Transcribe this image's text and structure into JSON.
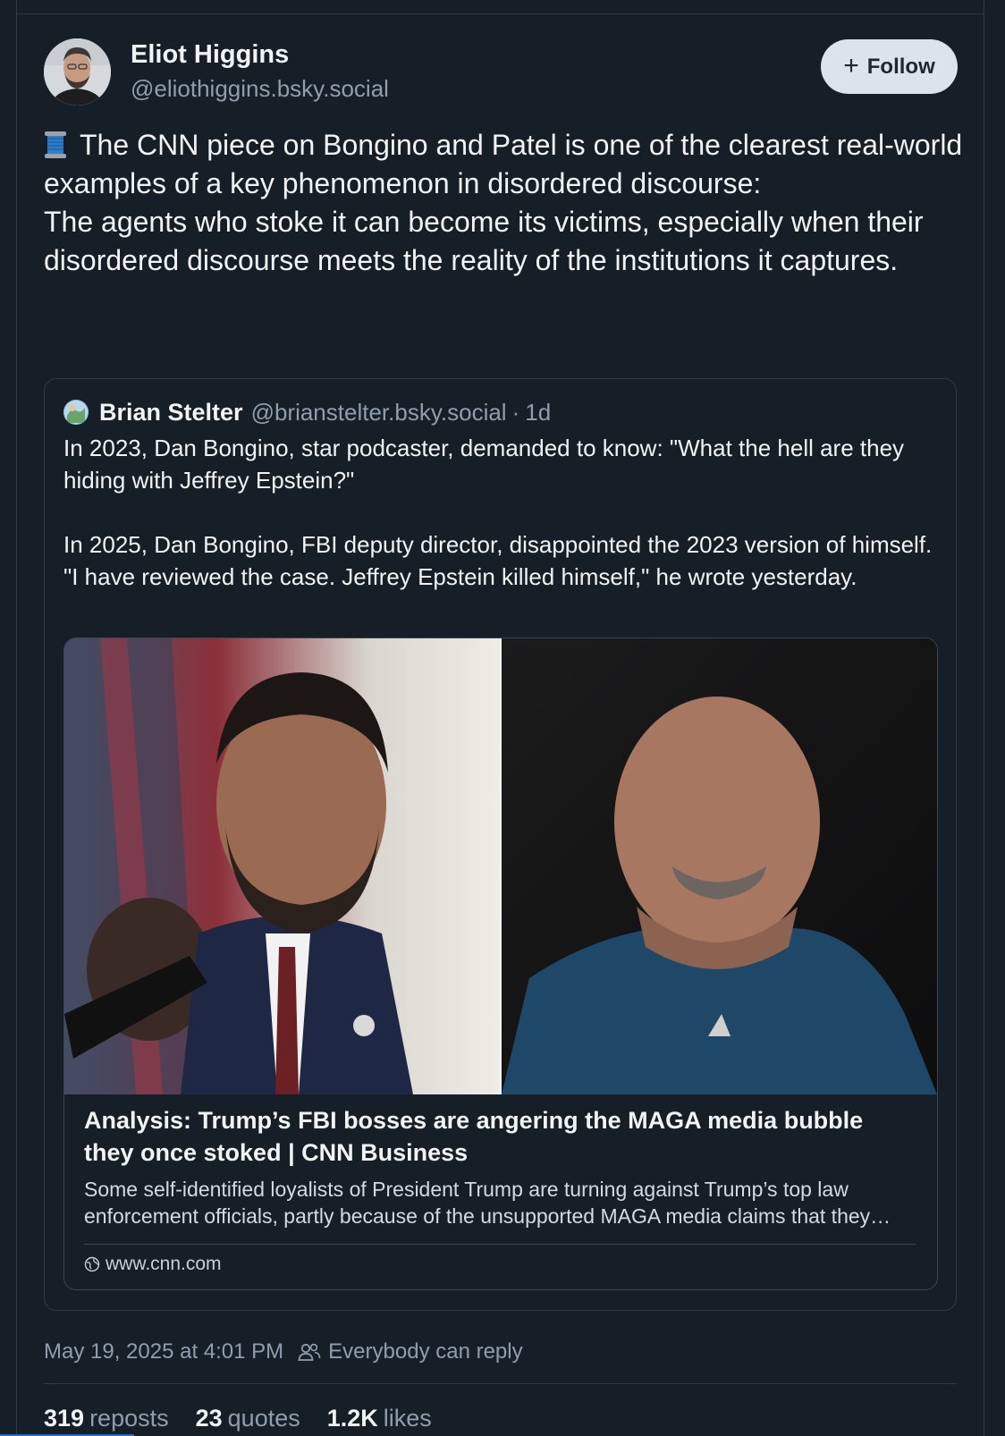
{
  "post": {
    "author": {
      "display_name": "Eliot Higgins",
      "handle": "@eliothiggins.bsky.social"
    },
    "follow_label": "Follow",
    "text_lines": [
      "The CNN piece on Bongino and Patel is one of the clearest real-world examples of a key phenomenon in disordered discourse:",
      "The agents who stoke it can become its victims, especially when their disordered discourse meets the reality of the institutions it captures."
    ],
    "timestamp": "May 19, 2025 at 4:01 PM",
    "reply_setting": "Everybody can reply",
    "stats": {
      "reposts_count": "319",
      "reposts_label": "reposts",
      "quotes_count": "23",
      "quotes_label": "quotes",
      "likes_count": "1.2K",
      "likes_label": "likes"
    }
  },
  "quote": {
    "display_name": "Brian Stelter",
    "handle": "@brianstelter.bsky.social",
    "separator": "·",
    "time": "1d",
    "paragraphs": [
      "In 2023, Dan Bongino, star podcaster, demanded to know: \"What the hell are they hiding with Jeffrey Epstein?\"",
      "In 2025, Dan Bongino, FBI deputy director, disappointed the 2023 version of himself. \"I have reviewed the case. Jeffrey Epstein killed himself,\" he wrote yesterday."
    ],
    "link_card": {
      "title": "Analysis: Trump’s FBI bosses are angering the MAGA media bubble they once stoked | CNN Business",
      "description": "Some self-identified loyalists of President Trump are turning against Trump’s top law enforcement officials, partly because of the unsupported MAGA media claims that they once spread...",
      "domain": "www.cnn.com"
    }
  },
  "icons": {
    "thread": "spool-of-thread-icon",
    "follow": "plus-icon",
    "globe": "globe-icon",
    "reply_setting": "people-icon"
  },
  "colors": {
    "background": "#161e27",
    "text_primary": "#f1f3f5",
    "text_secondary": "#8f9eae",
    "follow_button_bg": "#dbe3ec",
    "border": "#2e3a48"
  }
}
